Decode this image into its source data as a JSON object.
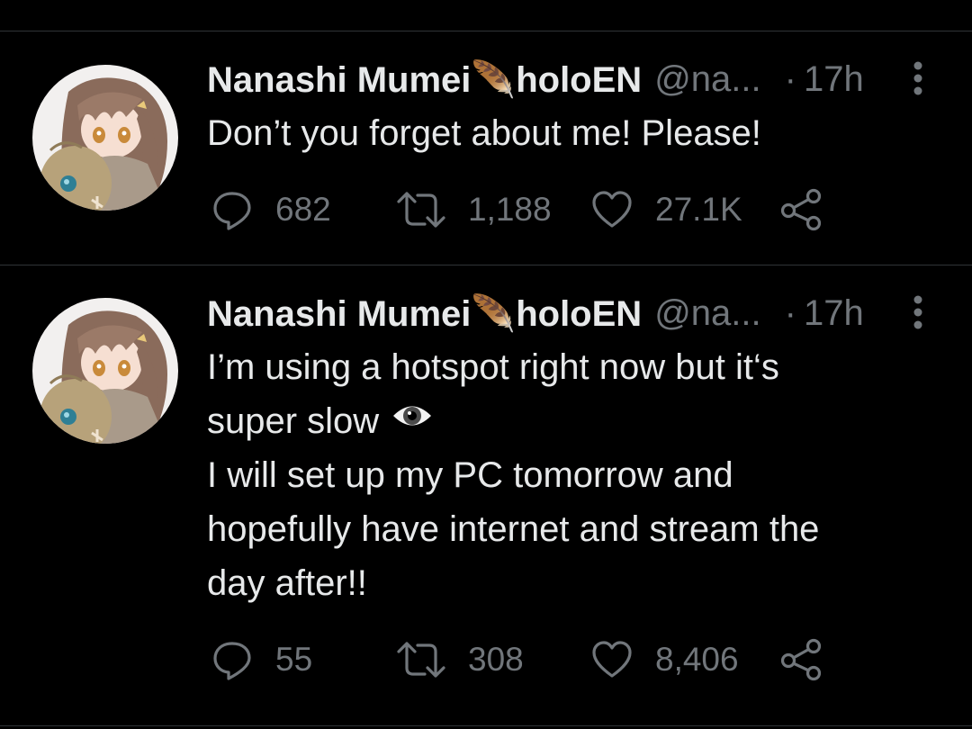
{
  "colors": {
    "background": "#000000",
    "text": "#e7e9ea",
    "secondary": "#71767b",
    "divider": "#2f3336"
  },
  "tweets": [
    {
      "author_name": "Nanashi Mumei🪶holoEN",
      "handle": "@na...",
      "separator": "·",
      "time": "17h",
      "text_lines": [
        "Don’t you forget about me! Please!"
      ],
      "replies": "682",
      "retweets": "1,188",
      "likes": "27.1K",
      "icons": [
        "avatar",
        "more-icon",
        "reply-icon",
        "retweet-icon",
        "like-icon",
        "share-icon"
      ]
    },
    {
      "author_name": "Nanashi Mumei🪶holoEN",
      "handle": "@na...",
      "separator": "·",
      "time": "17h",
      "text_lines": [
        "I’m using a hotspot right now but it‘s",
        "super slow",
        "I will set up my PC tomorrow and",
        "hopefully have internet and stream the",
        "day after!!"
      ],
      "emoji": "eye",
      "replies": "55",
      "retweets": "308",
      "likes": "8,406",
      "icons": [
        "avatar",
        "more-icon",
        "reply-icon",
        "retweet-icon",
        "like-icon",
        "share-icon",
        "eye-emoji"
      ]
    }
  ]
}
